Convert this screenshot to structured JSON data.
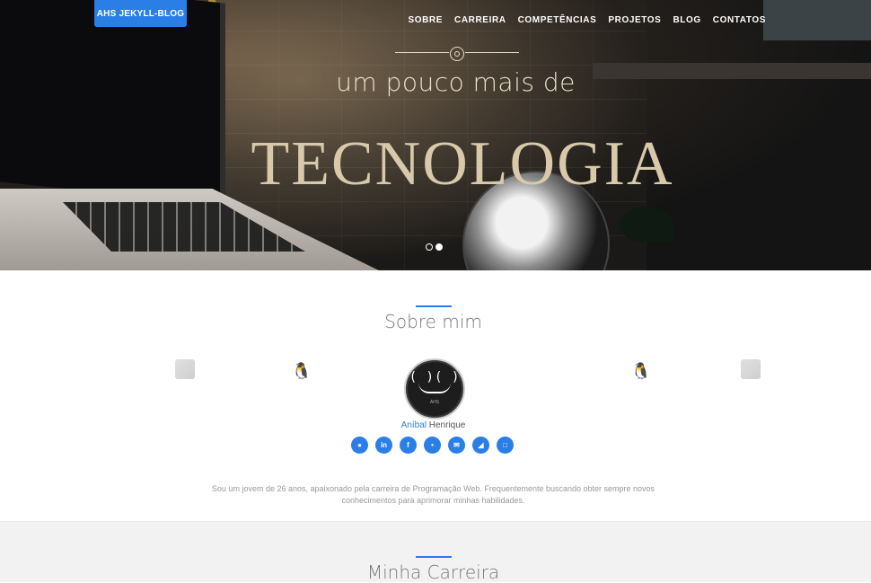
{
  "brand": "AHS JEKYLL-BLOG",
  "nav": [
    "SOBRE",
    "CARREIRA",
    "COMPETÊNCIAS",
    "PROJETOS",
    "BLOG",
    "CONTATOS"
  ],
  "hero": {
    "subtitle": "um pouco mais de",
    "title": "TECNOLOGIA",
    "slides": 2,
    "active_slide": 2
  },
  "about": {
    "heading": "Sobre mim",
    "name_first": "Aníbal",
    "name_last": "Henrique",
    "avatar_tiny_text": "AHS",
    "socials": [
      "github-icon",
      "linkedin-icon",
      "facebook-icon",
      "twitter-icon",
      "email-icon",
      "rss-icon",
      "pdf-icon"
    ],
    "bio": "Sou um jovem de 26 anos, apaixonado pela carreira de Programação Web. Frequentemente buscando obter sempre novos conhecimentos para aprimorar minhas habilidades."
  },
  "career": {
    "heading": "Minha Carreira"
  },
  "colors": {
    "accent": "#2a7ee6",
    "hero_text": "#d8c9aa"
  }
}
